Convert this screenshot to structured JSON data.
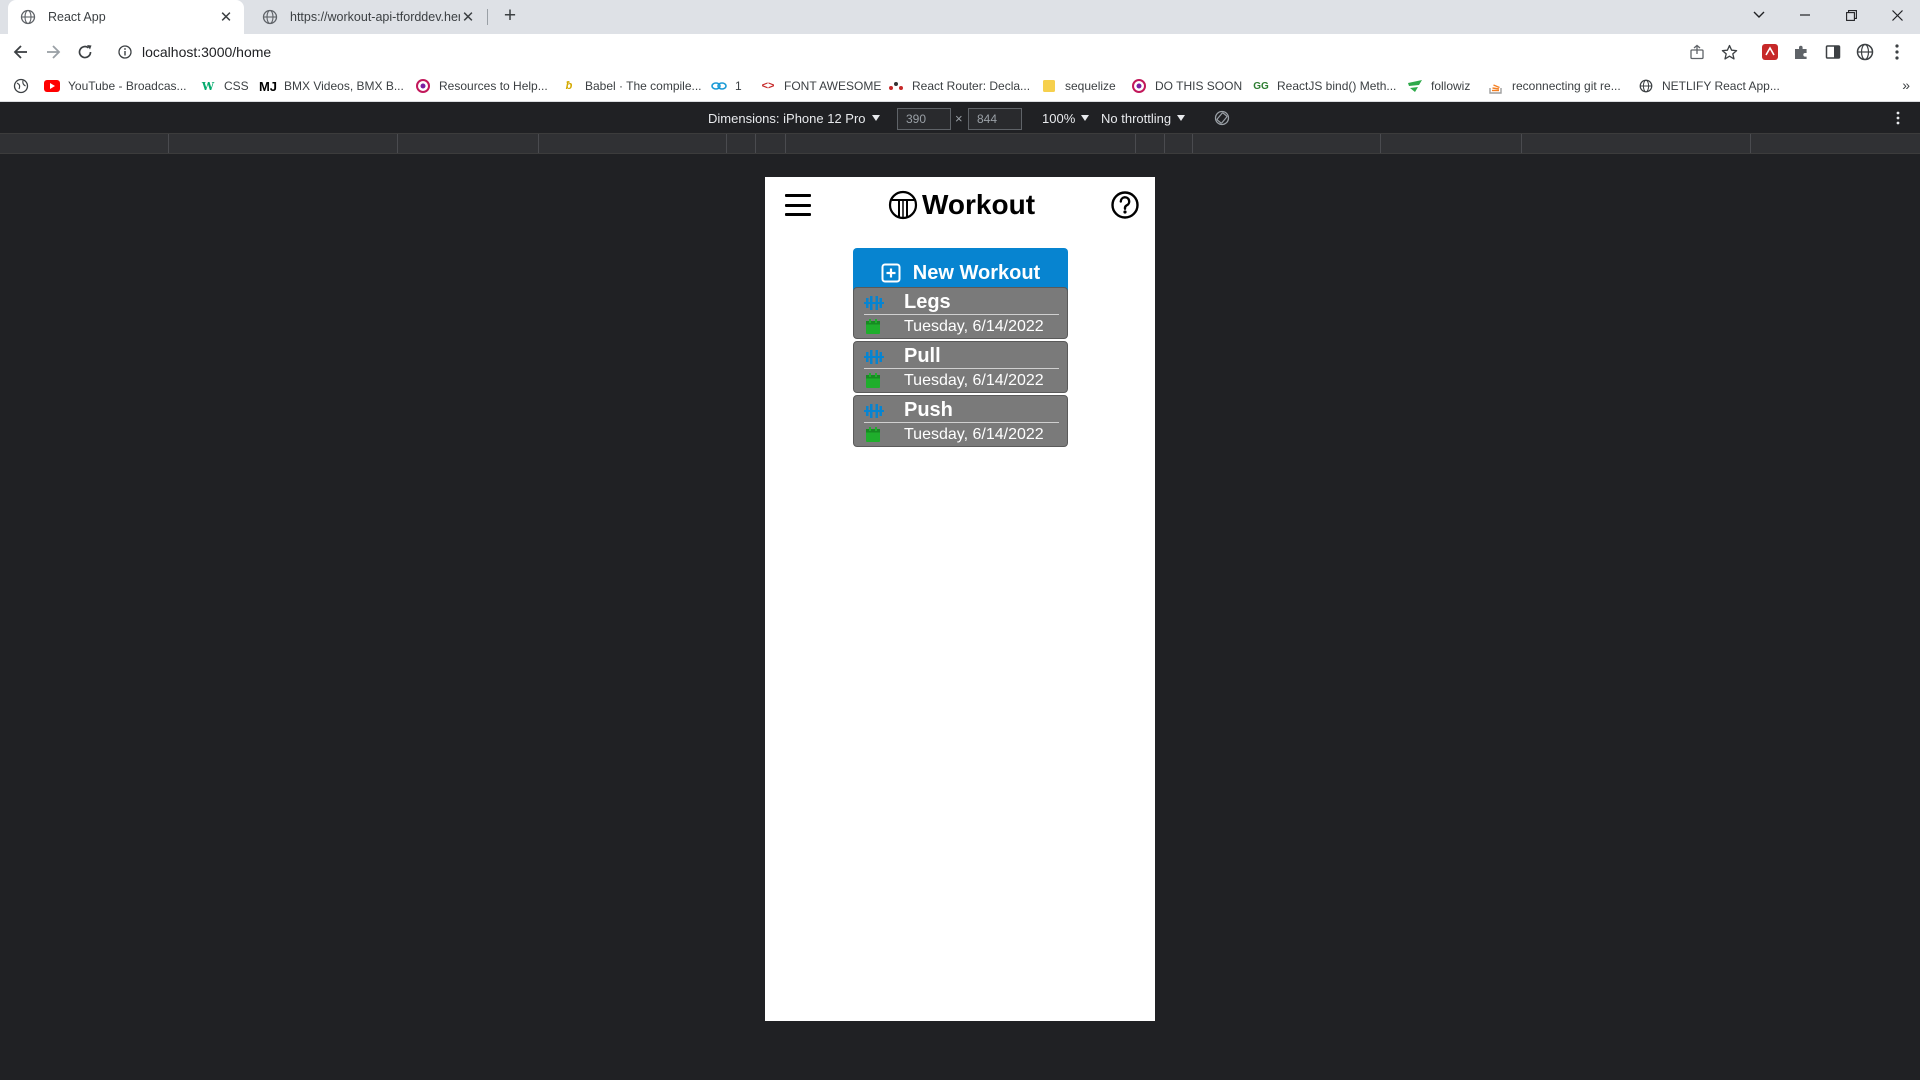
{
  "browser": {
    "tabs": [
      {
        "title": "React App",
        "active": true
      },
      {
        "title": "https://workout-api-tforddev.her"
      }
    ],
    "address": "localhost:3000/home",
    "bookmarks": [
      {
        "label": "YouTube - Broadcas...",
        "icon": "youtube-icon"
      },
      {
        "label": "CSS",
        "icon": "w3schools-icon"
      },
      {
        "label": "BMX Videos, BMX B...",
        "icon": "mj-icon"
      },
      {
        "label": "Resources to Help...",
        "icon": "resources-icon"
      },
      {
        "label": "Babel · The compile...",
        "icon": "babel-icon"
      },
      {
        "label": "1",
        "icon": "link-icon"
      },
      {
        "label": "FONT AWESOME",
        "icon": "code-icon"
      },
      {
        "label": "React Router: Decla...",
        "icon": "react-router-icon"
      },
      {
        "label": "sequelize",
        "icon": "folder-icon"
      },
      {
        "label": "DO THIS SOON",
        "icon": "do-this-icon"
      },
      {
        "label": "ReactJS bind() Meth...",
        "icon": "gfg-icon"
      },
      {
        "label": "followiz",
        "icon": "followiz-icon"
      },
      {
        "label": "reconnecting git re...",
        "icon": "stackoverflow-icon"
      },
      {
        "label": "NETLIFY React App...",
        "icon": "globe-icon"
      }
    ]
  },
  "devtools": {
    "device": "Dimensions: iPhone 12 Pro",
    "width": "390",
    "times": "×",
    "height": "844",
    "zoom": "100%",
    "throttling": "No throttling"
  },
  "app": {
    "title": "Workout",
    "new_button": "New Workout",
    "workouts": [
      {
        "name": "Legs",
        "date": "Tuesday, 6/14/2022"
      },
      {
        "name": "Pull",
        "date": "Tuesday, 6/14/2022"
      },
      {
        "name": "Push",
        "date": "Tuesday, 6/14/2022"
      }
    ],
    "colors": {
      "primary": "#0784d0",
      "card": "#7a7a7a",
      "dumbbell": "#0784d0",
      "calendar": "#1fae2c"
    }
  }
}
